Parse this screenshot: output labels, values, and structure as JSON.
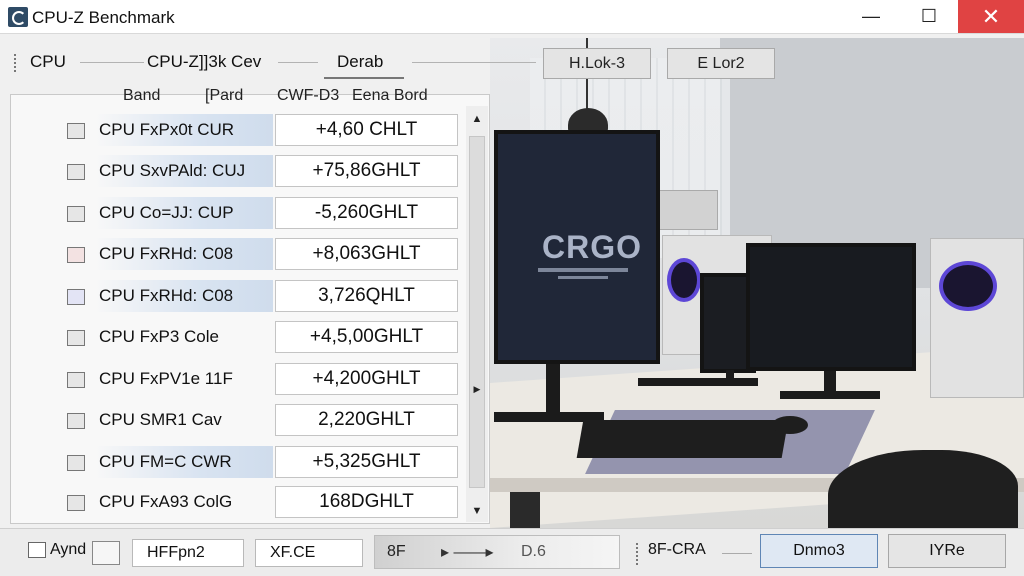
{
  "window": {
    "title": "CPU-Z Benchmark",
    "minimize": "—",
    "maximize": "☐",
    "close": "✕"
  },
  "tabs": {
    "items": [
      "CPU",
      "CPU-Z]]3k Cev",
      "Derab"
    ],
    "active_index": 2
  },
  "toolbar": {
    "button1": "H.Lok-3",
    "button2": "E Lor2"
  },
  "subtabs": [
    "Band",
    "[Pard",
    "CWF-D3",
    "Eena Bord"
  ],
  "rows": [
    {
      "icon": "chip-icon",
      "label": "CPU FxPx0t CUR",
      "value": "+4,60 CHLT",
      "highlighted": true
    },
    {
      "icon": "processor-icon",
      "label": "CPU SxvPAld: CUJ",
      "value": "+75,86GHLT",
      "highlighted": true
    },
    {
      "icon": "memory-icon",
      "label": "CPU Co=JJ: CUP",
      "value": "-5,260GHLT",
      "highlighted": true
    },
    {
      "icon": "gpu-icon",
      "label": "CPU FxRHd: C08",
      "value": "+8,063GHLT",
      "highlighted": true
    },
    {
      "icon": "motherboard-icon",
      "label": "CPU FxRHd: C08",
      "value": "3,726QHLT",
      "highlighted": true
    },
    {
      "icon": "audio-icon",
      "label": "CPU FxP3 Cole",
      "value": "+4,5,00GHLT",
      "highlighted": false
    },
    {
      "icon": "storage-icon",
      "label": "CPU FxPV1e 11F",
      "value": "+4,200GHLT",
      "highlighted": false
    },
    {
      "icon": "drive-icon",
      "label": "CPU SMR1 Cav",
      "value": "2,220GHLT",
      "highlighted": false
    },
    {
      "icon": "network-icon",
      "label": "CPU FM=C CWR",
      "value": "+5,325GHLT",
      "highlighted": true
    },
    {
      "icon": "display-icon",
      "label": "CPU FxA93 ColG",
      "value": "168DGHLT",
      "highlighted": false
    }
  ],
  "scroll": {
    "up": "▲",
    "down": "▼",
    "right": "▶"
  },
  "footer": {
    "checkbox_label": "Aynd",
    "field1": "HFFpn2",
    "field2": "XF.CE",
    "progress_start": "8F",
    "progress_arrow": "▸ ——▸",
    "progress_end": "D.6",
    "text": "8F-CRA",
    "primary_button": "Dnmo3",
    "secondary_button": "IYRe"
  },
  "monitor_text": "CRGO",
  "colors": {
    "close_button": "#e04343",
    "row_highlight": "#d8e3f1",
    "primary_button_border": "#5f86b5",
    "case_fan_glow": "#5d47d6"
  }
}
